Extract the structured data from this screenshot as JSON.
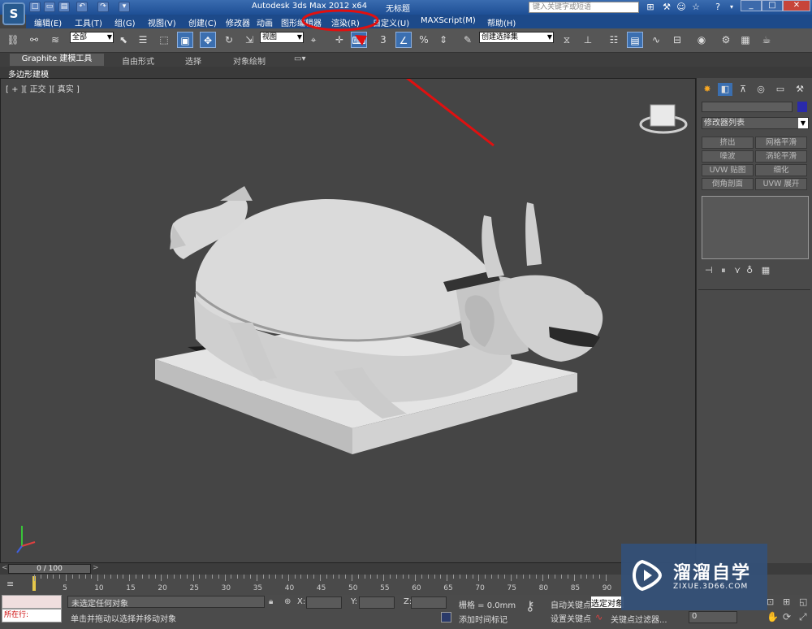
{
  "window": {
    "title": "Autodesk 3ds Max  2012 x64",
    "file": "无标题",
    "search_placeholder": "键入关键字或短语",
    "controls": [
      "_",
      "□",
      "✕"
    ]
  },
  "quick_access": [
    "□",
    "▭",
    "▤",
    "↶",
    "↷",
    "▾"
  ],
  "menu": [
    "编辑(E)",
    "工具(T)",
    "组(G)",
    "视图(V)",
    "创建(C)",
    "修改器",
    "动画",
    "图形编辑器",
    "渲染(R)",
    "自定义(U)",
    "MAXScript(M)",
    "帮助(H)"
  ],
  "toolbar": {
    "selection_filter": "全部",
    "reference_coord": "视图",
    "named_selection": "创建选择集"
  },
  "ribbon": {
    "tabs": [
      "Graphite 建模工具",
      "自由形式",
      "选择",
      "对象绘制"
    ],
    "sub_label": "多边形建模"
  },
  "viewport": {
    "label": "[ + ][ 正交 ][ 真实 ]"
  },
  "command_panel": {
    "modifier_list": "修改器列表",
    "buttons": [
      "挤出",
      "网格平滑",
      "噪波",
      "涡轮平滑",
      "UVW 贴图",
      "细化",
      "倒角剖面",
      "UVW 展开"
    ]
  },
  "timeline": {
    "frame": "0 / 100",
    "ticks": [
      "5",
      "10",
      "15",
      "20",
      "25",
      "30",
      "35",
      "40",
      "45",
      "50",
      "55",
      "60",
      "65",
      "70",
      "75",
      "80",
      "85",
      "90"
    ]
  },
  "status": {
    "running": "所在行:",
    "selection": "未选定任何对象",
    "prompt": "单击并拖动以选择并移动对象",
    "x_label": "X:",
    "y_label": "Y:",
    "z_label": "Z:",
    "grid": "栅格 = 0.0mm",
    "add_time_tag": "添加时间标记",
    "auto_key": "自动关键点",
    "set_key": "设置关键点",
    "selected_object": "选定对象",
    "key_filter": "关键点过滤器...",
    "frame_value": "0"
  },
  "watermark": {
    "title": "溜溜自学",
    "url": "ZIXUE.3D66.COM"
  },
  "colors": {
    "annotation_red": "#e01010",
    "accent_blue": "#3b6fb0"
  }
}
